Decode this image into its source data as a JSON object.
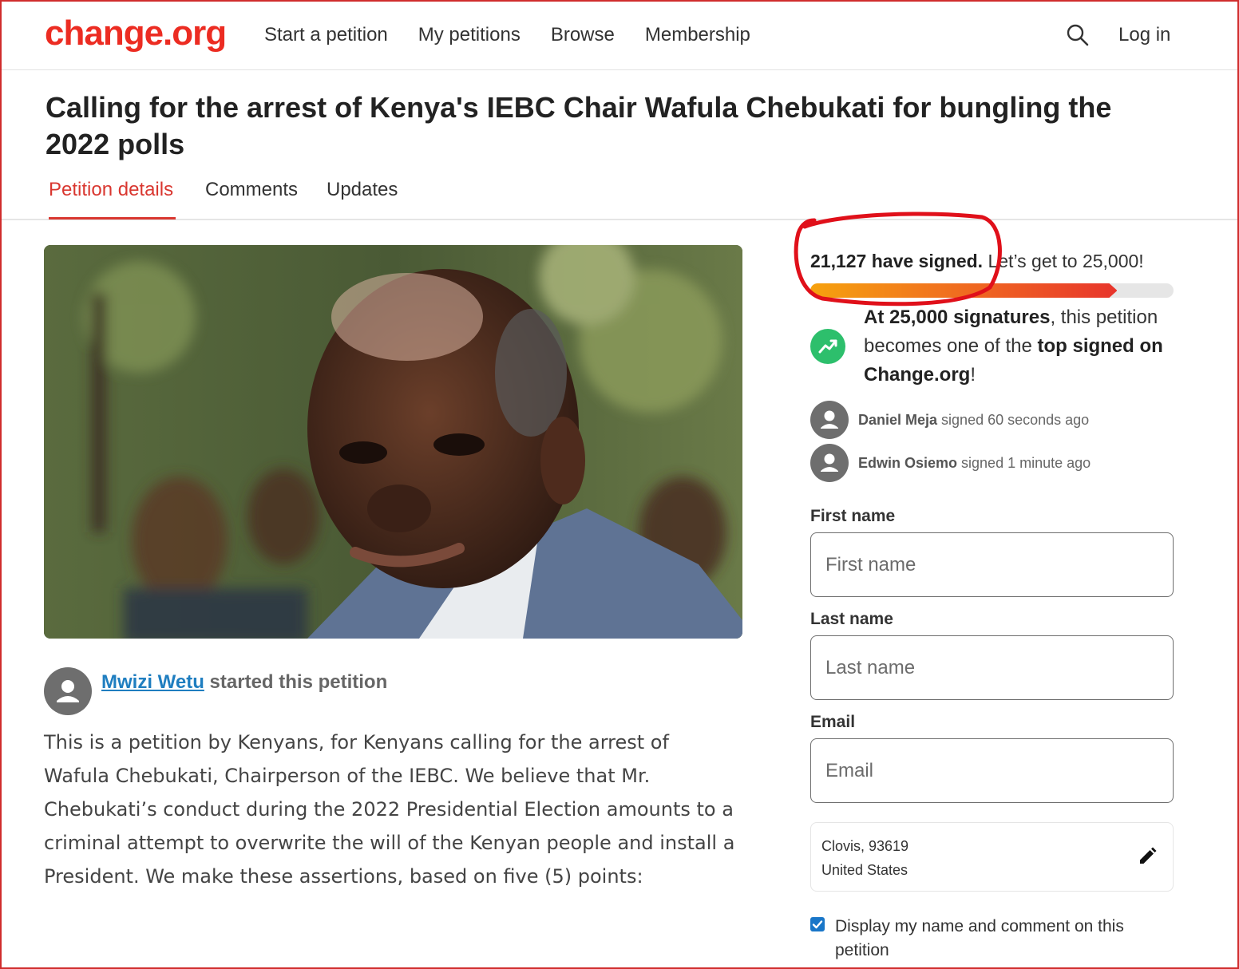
{
  "header": {
    "logo": "change.org",
    "nav": [
      "Start a petition",
      "My petitions",
      "Browse",
      "Membership"
    ],
    "login": "Log in",
    "search_icon": "search-icon"
  },
  "petition": {
    "title": "Calling for the arrest of Kenya's IEBC Chair Wafula Chebukati for bungling the 2022 polls",
    "tabs": [
      "Petition details",
      "Comments",
      "Updates"
    ],
    "active_tab": "Petition details",
    "starter_name": "Mwizi Wetu",
    "starter_suffix": " started this petition",
    "body": "This is a petition by Kenyans, for Kenyans calling for the arrest of Wafula Chebukati, Chairperson of the IEBC. We believe that Mr. Chebukati’s conduct during the 2022 Presidential Election amounts to a criminal attempt to overwrite the will of the Kenyan people and install a President. We make these assertions, based on five (5) points:"
  },
  "signatures": {
    "count_text": "21,127 have signed.",
    "goal_text": " Let’s get to 25,000!",
    "progress_fraction": 0.845,
    "milestone_bold1": "At 25,000 signatures",
    "milestone_text1": ", this petition becomes one of the ",
    "milestone_bold2": "top signed on Change.org",
    "milestone_text2": "!",
    "recent": [
      {
        "name": "Daniel Meja",
        "action": " signed 60 seconds ago"
      },
      {
        "name": "Edwin Osiemo",
        "action": " signed 1 minute ago"
      }
    ]
  },
  "form": {
    "first_name_label": "First name",
    "first_name_placeholder": "First name",
    "last_name_label": "Last name",
    "last_name_placeholder": "Last name",
    "email_label": "Email",
    "email_placeholder": "Email",
    "location_line1": "Clovis, 93619",
    "location_line2": "United States",
    "display_checkbox_label": "Display my name and comment on this petition",
    "display_checked": true
  },
  "colors": {
    "brand": "#ec2c22",
    "active_tab": "#d93730",
    "link": "#1f7ec0",
    "milestone_icon": "#2dbf6c",
    "checkbox": "#1976c8",
    "annotation": "#e0101a"
  }
}
